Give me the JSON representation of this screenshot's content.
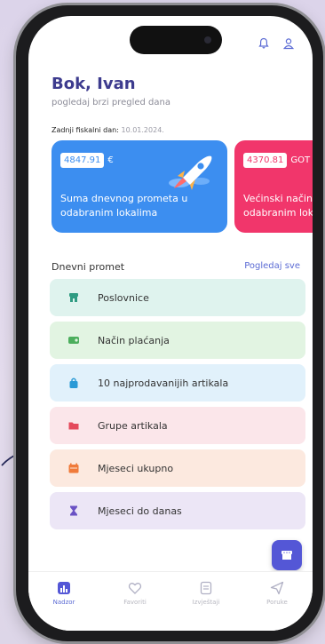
{
  "header": {
    "greeting": "Bok, Ivan",
    "subtitle": "pogledaj brzi pregled dana",
    "fiscal_label": "Zadnji fiskalni dan:",
    "fiscal_date": "10.01.2024."
  },
  "cards": [
    {
      "amount": "4847.91",
      "currency": "€",
      "label": "Suma dnevnog prometa u odabranim lokalima",
      "color": "#3c8ef0"
    },
    {
      "amount": "4370.81",
      "currency": "GOT",
      "label": "Većinski način odabranim lok",
      "color": "#f1366b"
    }
  ],
  "section": {
    "title": "Dnevni promet",
    "link": "Pogledaj sve"
  },
  "list": [
    {
      "label": "Poslovnice",
      "icon": "store-icon",
      "bg": "#dff3ee",
      "fg": "#2f9b82"
    },
    {
      "label": "Način plaćanja",
      "icon": "wallet-icon",
      "bg": "#e2f4e2",
      "fg": "#4cae5d"
    },
    {
      "label": "10 najprodavanijih artikala",
      "icon": "bag-icon",
      "bg": "#e1f1fb",
      "fg": "#2a9ad6"
    },
    {
      "label": "Grupe artikala",
      "icon": "folder-icon",
      "bg": "#fbe6ea",
      "fg": "#e44a5c"
    },
    {
      "label": "Mjeseci ukupno",
      "icon": "calendar-icon",
      "bg": "#fce9df",
      "fg": "#f07a3a"
    },
    {
      "label": "Mjeseci do danas",
      "icon": "hourglass-icon",
      "bg": "#ece6f6",
      "fg": "#6a52c4"
    }
  ],
  "nav": [
    {
      "label": "Nadzor",
      "icon": "chart-icon",
      "active": true
    },
    {
      "label": "Favoriti",
      "icon": "heart-icon",
      "active": false
    },
    {
      "label": "Izvještaji",
      "icon": "report-icon",
      "active": false
    },
    {
      "label": "Poruke",
      "icon": "send-icon",
      "active": false
    }
  ],
  "colors": {
    "accent": "#5457d6",
    "title": "#3d3b8e"
  }
}
